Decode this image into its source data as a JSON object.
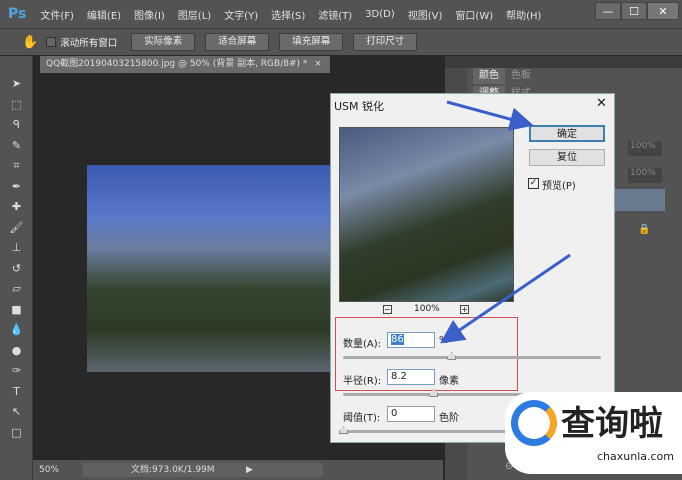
{
  "app": {
    "logo": "Ps",
    "menus": [
      "文件(F)",
      "编辑(E)",
      "图像(I)",
      "图层(L)",
      "文字(Y)",
      "选择(S)",
      "滤镜(T)",
      "3D(D)",
      "视图(V)",
      "窗口(W)",
      "帮助(H)"
    ],
    "window_controls": [
      "—",
      "☐",
      "✕"
    ]
  },
  "options": {
    "scroll_all_label": "滚动所有窗口",
    "buttons": [
      "实际像素",
      "适合屏幕",
      "填充屏幕",
      "打印尺寸"
    ]
  },
  "document": {
    "tab_title": "QQ截图20190403215800.jpg @ 50% (背景 副本, RGB/8#) *",
    "close": "×",
    "zoom": "50%",
    "doc_info": "文档:973.0K/1.99M"
  },
  "panels": {
    "tabs1": [
      "颜色",
      "色板"
    ],
    "tabs2": [
      "调整",
      "样式"
    ],
    "opacity1": "100%",
    "opacity2": "100%"
  },
  "dialog": {
    "title": "USM 锐化",
    "ok": "确定",
    "reset": "复位",
    "preview_label": "预览(P)",
    "preview_checked": true,
    "preview_zoom": "100%",
    "amount_label": "数量(A):",
    "amount_value": "86",
    "amount_unit": "%",
    "amount_slider": 0.42,
    "radius_label": "半径(R):",
    "radius_value": "8.2",
    "radius_unit": "像素",
    "radius_slider": 0.35,
    "threshold_label": "阈值(T):",
    "threshold_value": "0",
    "threshold_unit": "色阶",
    "threshold_slider": 0
  },
  "watermark": {
    "brand": "查询啦",
    "url": "chaxunla.com"
  },
  "colors": {
    "arrow": "#3b5fc9",
    "highlight_box": "#d05050",
    "accent": "#4fa3e0"
  }
}
